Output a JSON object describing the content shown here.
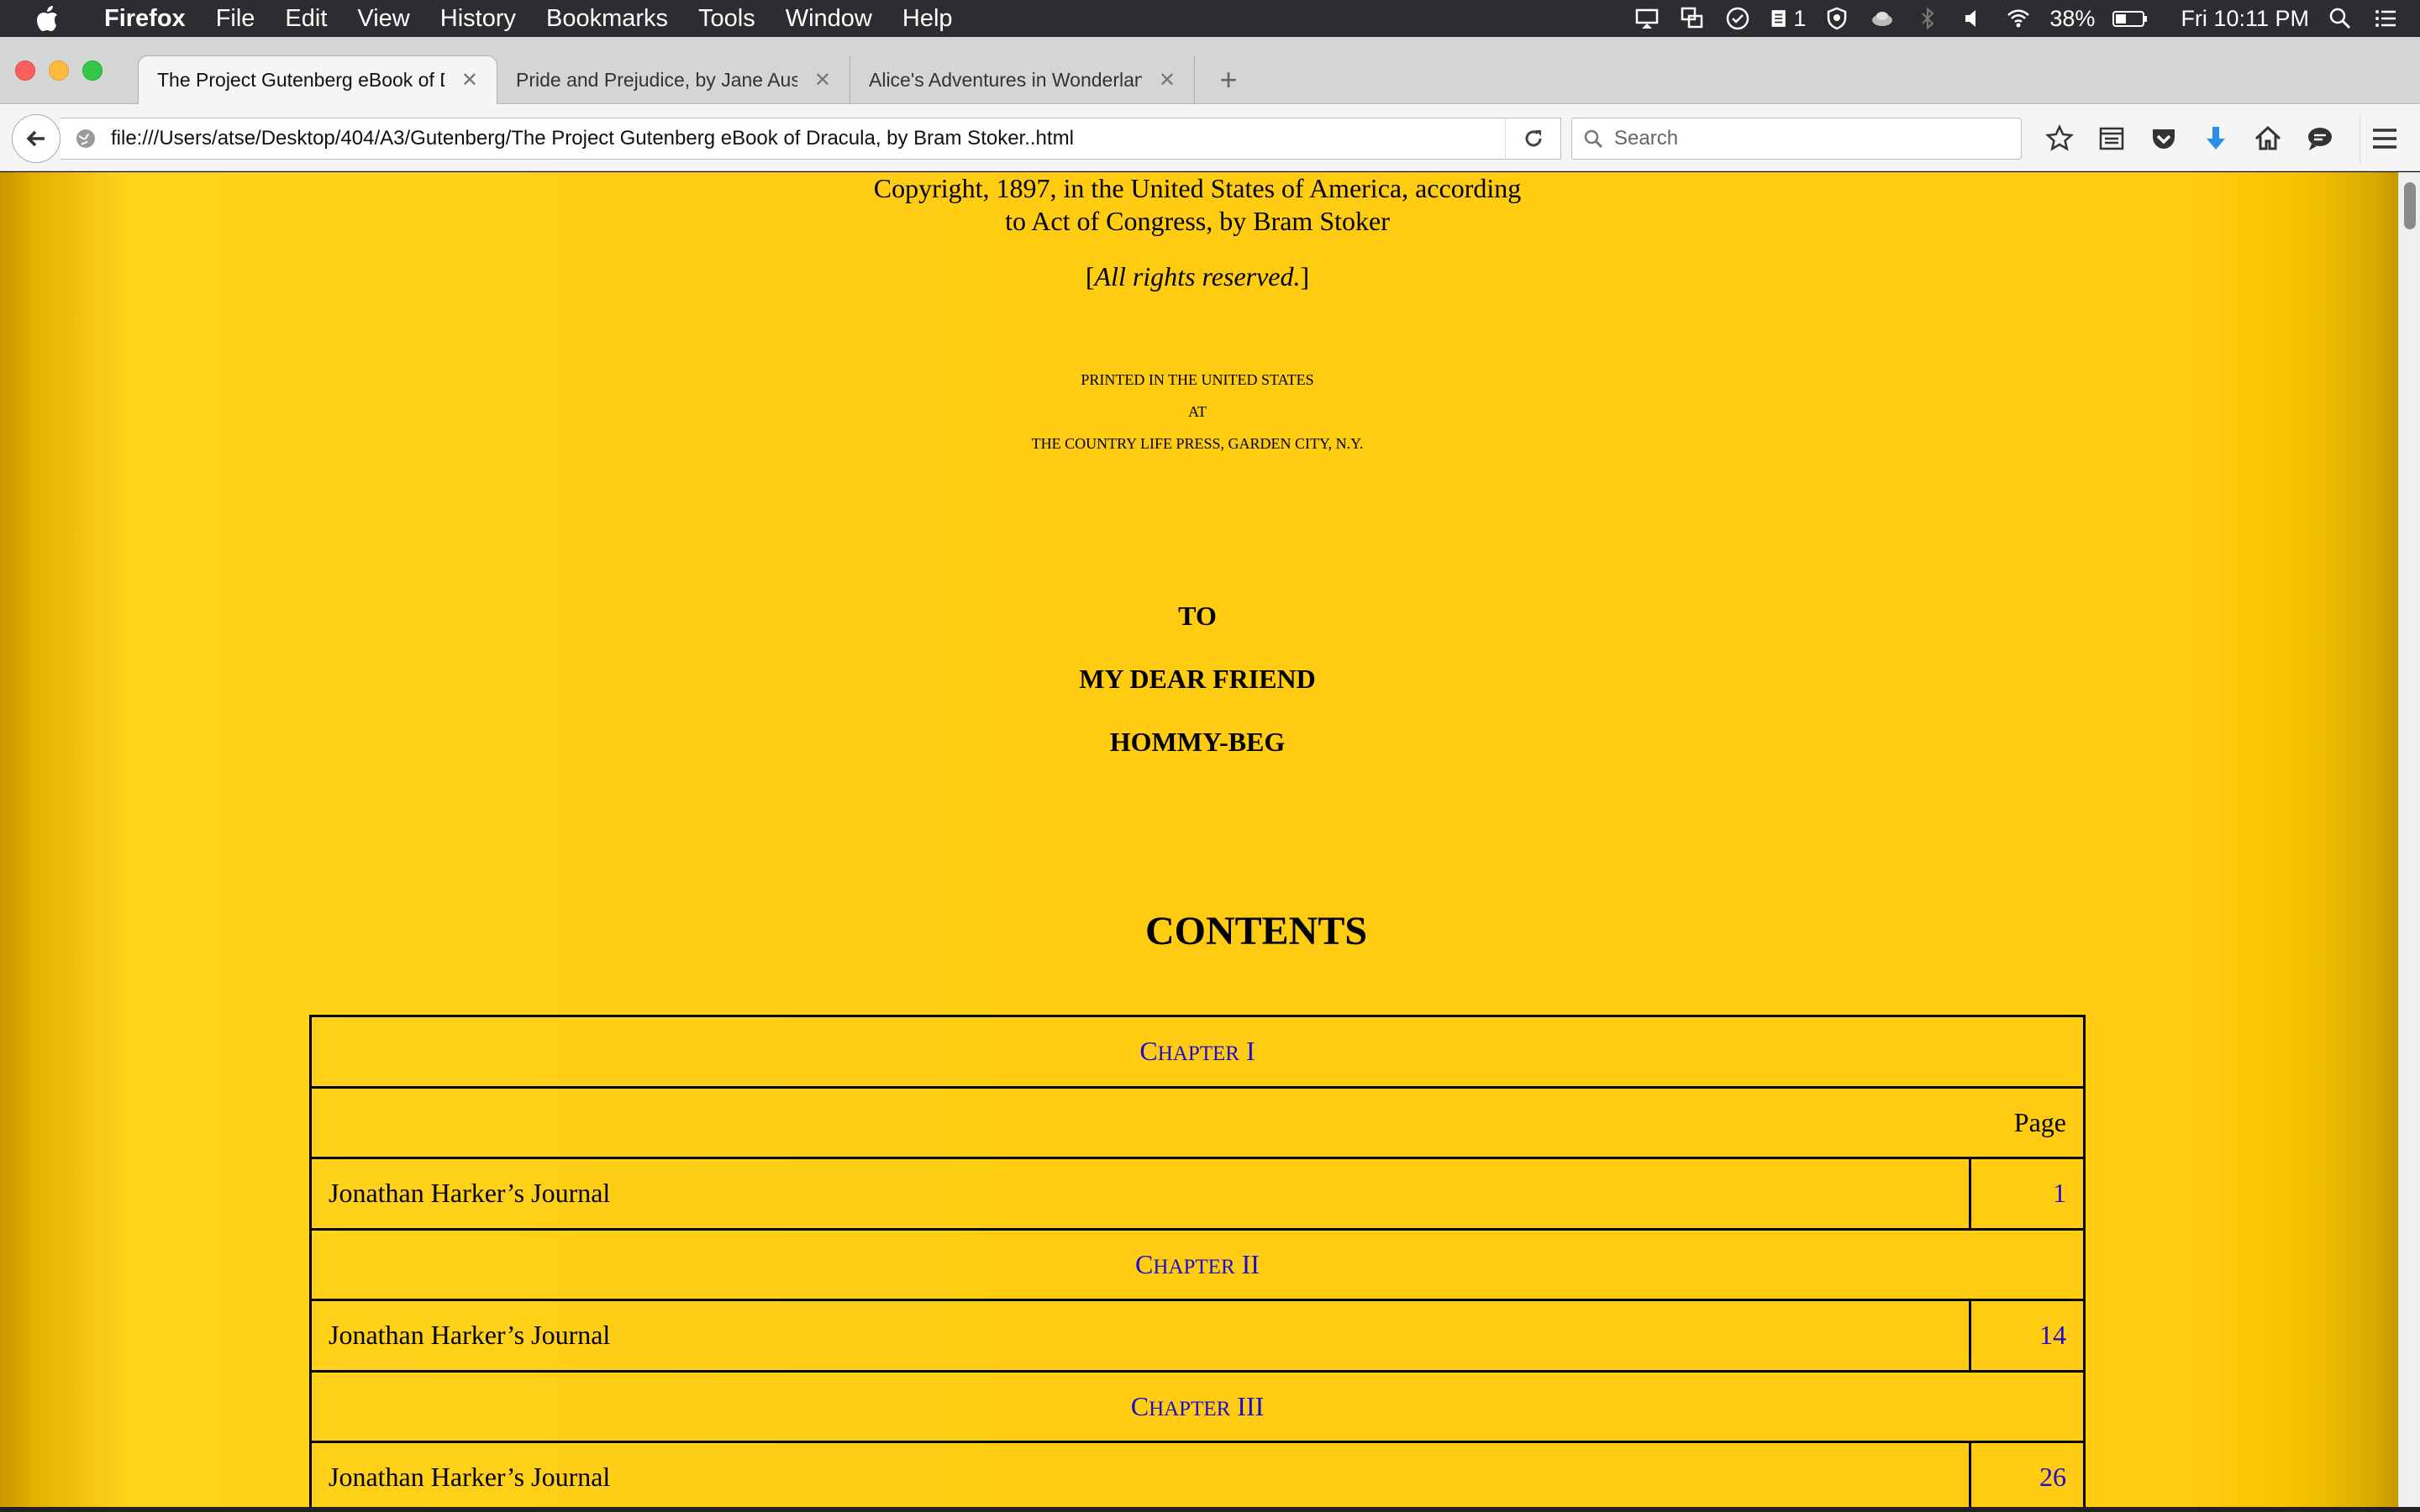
{
  "menubar": {
    "app": "Firefox",
    "items": [
      "File",
      "Edit",
      "View",
      "History",
      "Bookmarks",
      "Tools",
      "Window",
      "Help"
    ],
    "badge_count": "1",
    "battery": "38%",
    "clock": "Fri 10:11 PM"
  },
  "tabs": [
    {
      "label": "The Project Gutenberg eBook of D...",
      "active": true
    },
    {
      "label": "Pride and Prejudice, by Jane Austen",
      "active": false
    },
    {
      "label": "Alice's Adventures in Wonderland, ...",
      "active": false
    }
  ],
  "navbar": {
    "url": "file:///Users/atse/Desktop/404/A3/Gutenberg/The Project Gutenberg eBook of Dracula, by Bram Stoker..html",
    "search_placeholder": "Search"
  },
  "page": {
    "copyright_line1": "Copyright, 1897, in the United States of America, according",
    "copyright_line2": "to Act of Congress, by Bram Stoker",
    "rights": "All rights reserved.",
    "printed_line1": "PRINTED IN THE UNITED STATES",
    "printed_line2": "AT",
    "printed_line3": "THE COUNTRY LIFE PRESS, GARDEN CITY, N.Y.",
    "dedication": [
      "TO",
      "MY DEAR FRIEND",
      "HOMMY-BEG"
    ],
    "contents_heading": "CONTENTS",
    "page_header": "Page",
    "toc": [
      {
        "chapter_initial": "C",
        "chapter_rest": "HAPTER",
        "numeral": "I",
        "title": "Jonathan Harker’s Journal",
        "page": "1"
      },
      {
        "chapter_initial": "C",
        "chapter_rest": "HAPTER",
        "numeral": "II",
        "title": "Jonathan Harker’s Journal",
        "page": "14"
      },
      {
        "chapter_initial": "C",
        "chapter_rest": "HAPTER",
        "numeral": "III",
        "title": "Jonathan Harker’s Journal",
        "page": "26"
      }
    ]
  },
  "colors": {
    "page_background": "#ffcc11",
    "link": "#1a0dcc",
    "menubar": "#2b2d30",
    "download_arrow": "#2a8ee8"
  },
  "icons": [
    "apple-icon",
    "cast-icon",
    "screens-icon",
    "check-circle-icon",
    "notes-icon",
    "shield-icon",
    "cloud-icon",
    "bluetooth-icon",
    "volume-icon",
    "wifi-icon",
    "battery-icon",
    "spotlight-icon",
    "notification-center-icon",
    "back-arrow-icon",
    "site-info-icon",
    "reload-icon",
    "search-icon",
    "bookmark-star-icon",
    "reading-list-icon",
    "pocket-icon",
    "download-icon",
    "home-icon",
    "chat-icon",
    "hamburger-menu-icon"
  ]
}
